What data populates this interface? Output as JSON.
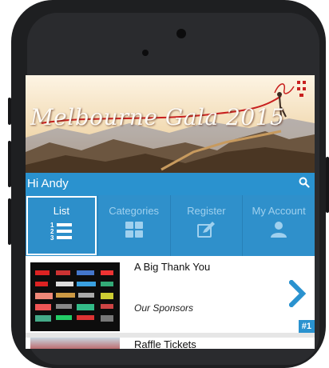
{
  "banner": {
    "title": "Melbourne Gala 2015"
  },
  "header": {
    "greeting": "Hi Andy",
    "search_icon": "search-icon"
  },
  "tabs": [
    {
      "label": "List",
      "icon": "list-icon",
      "active": true
    },
    {
      "label": "Categories",
      "icon": "grid-icon",
      "active": false
    },
    {
      "label": "Register",
      "icon": "edit-icon",
      "active": false
    },
    {
      "label": "My Account",
      "icon": "user-icon",
      "active": false
    }
  ],
  "items": [
    {
      "title": "A Big Thank You",
      "subtitle": "Our Sponsors",
      "badge": "#1"
    },
    {
      "title": "Raffle Tickets"
    }
  ],
  "colors": {
    "accent": "#2a92cf",
    "tabs": "#2f90cb"
  }
}
